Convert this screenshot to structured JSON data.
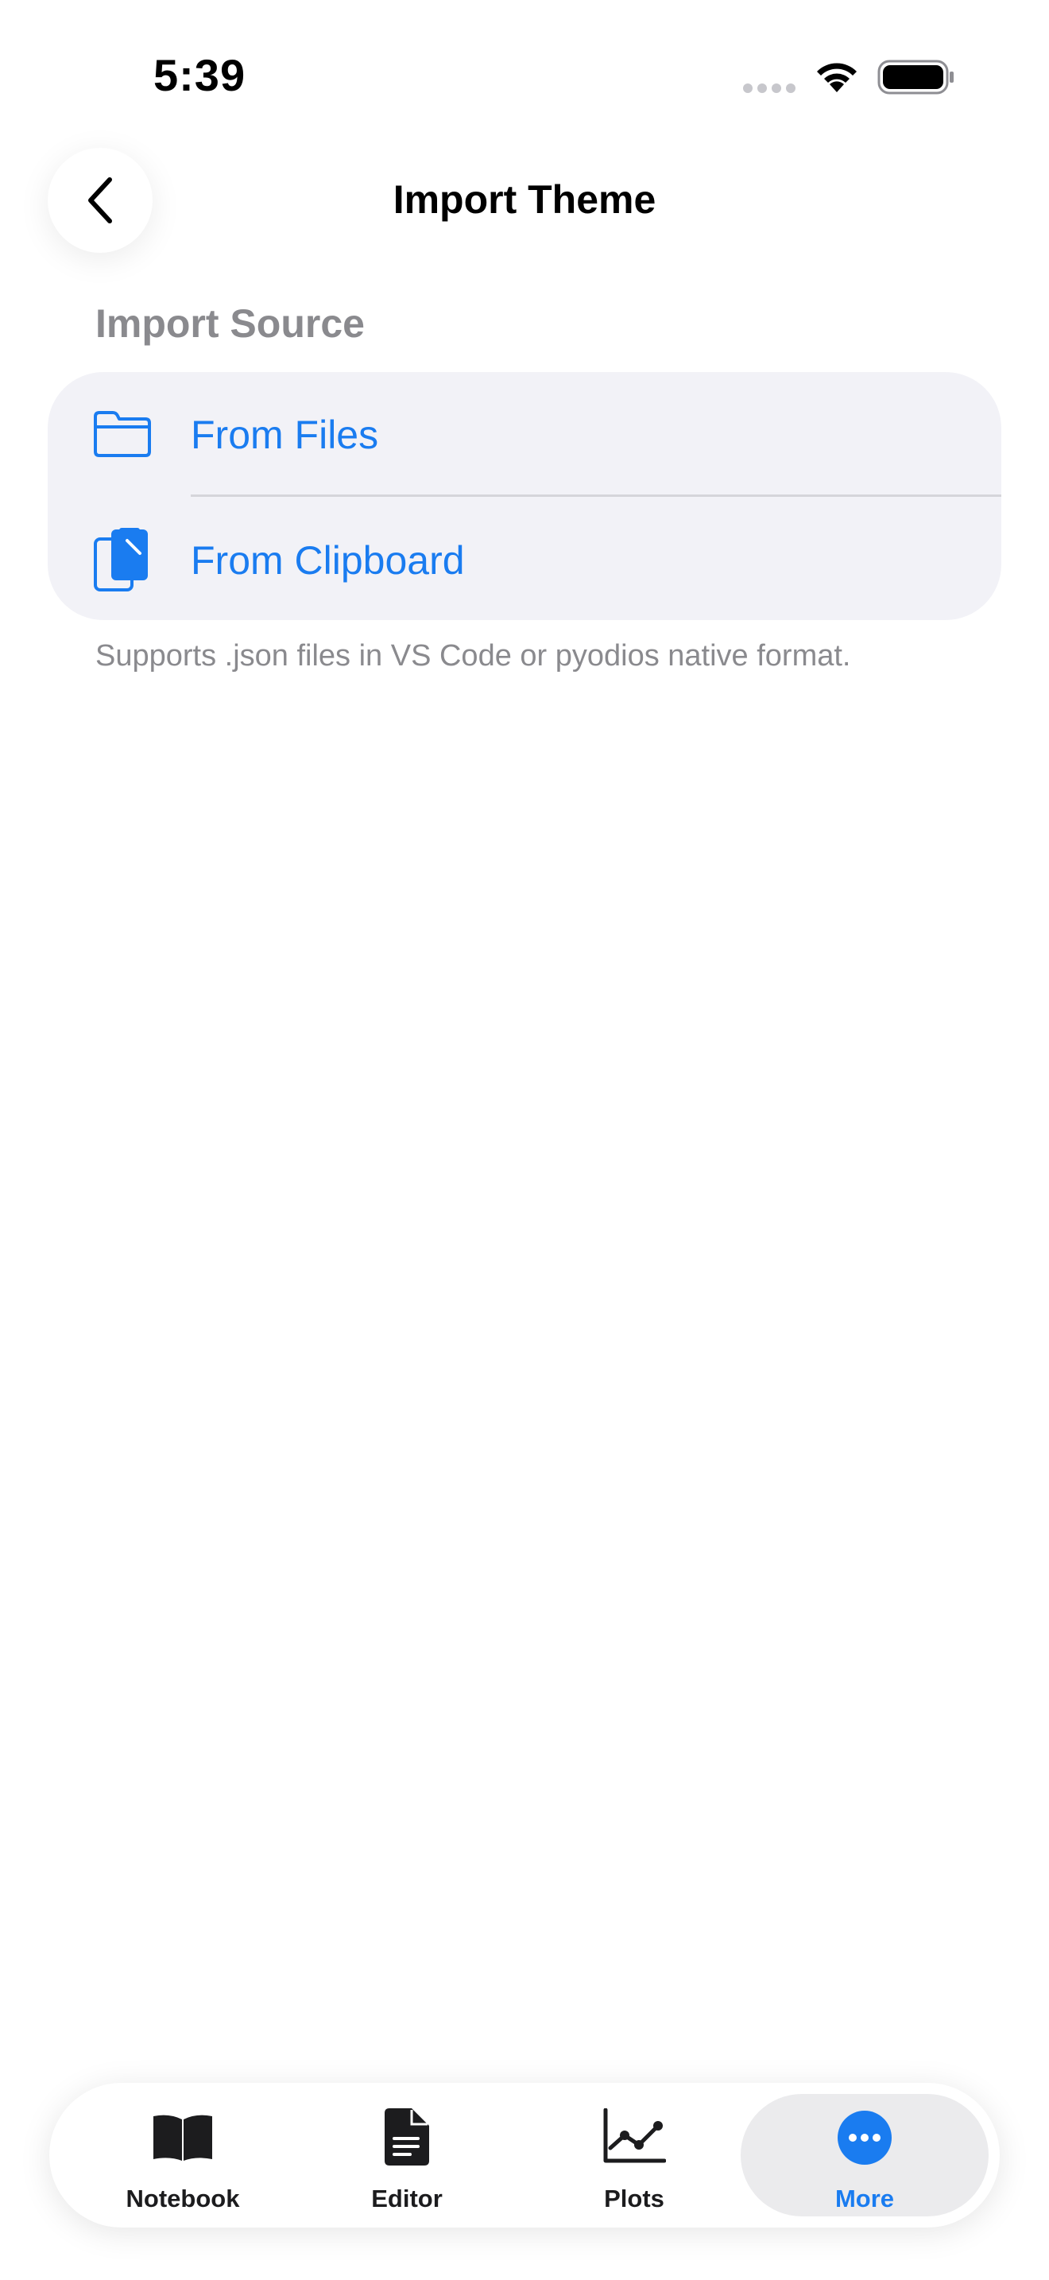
{
  "status_bar": {
    "time": "5:39"
  },
  "nav": {
    "title": "Import Theme",
    "back_icon": "chevron-left-icon"
  },
  "section": {
    "header": "Import Source",
    "rows": [
      {
        "label": "From Files",
        "icon": "folder-icon"
      },
      {
        "label": "From Clipboard",
        "icon": "clipboard-icon"
      }
    ],
    "footer": "Supports .json files in VS Code or pyodios native format."
  },
  "tab_bar": {
    "tabs": [
      {
        "label": "Notebook",
        "icon": "book-icon",
        "active": false
      },
      {
        "label": "Editor",
        "icon": "document-icon",
        "active": false
      },
      {
        "label": "Plots",
        "icon": "chart-line-icon",
        "active": false
      },
      {
        "label": "More",
        "icon": "ellipsis-circle-icon",
        "active": true
      }
    ]
  },
  "colors": {
    "accent": "#1a7cf0",
    "group_background": "#f2f2f7",
    "secondary_text": "#8a8a8e"
  }
}
